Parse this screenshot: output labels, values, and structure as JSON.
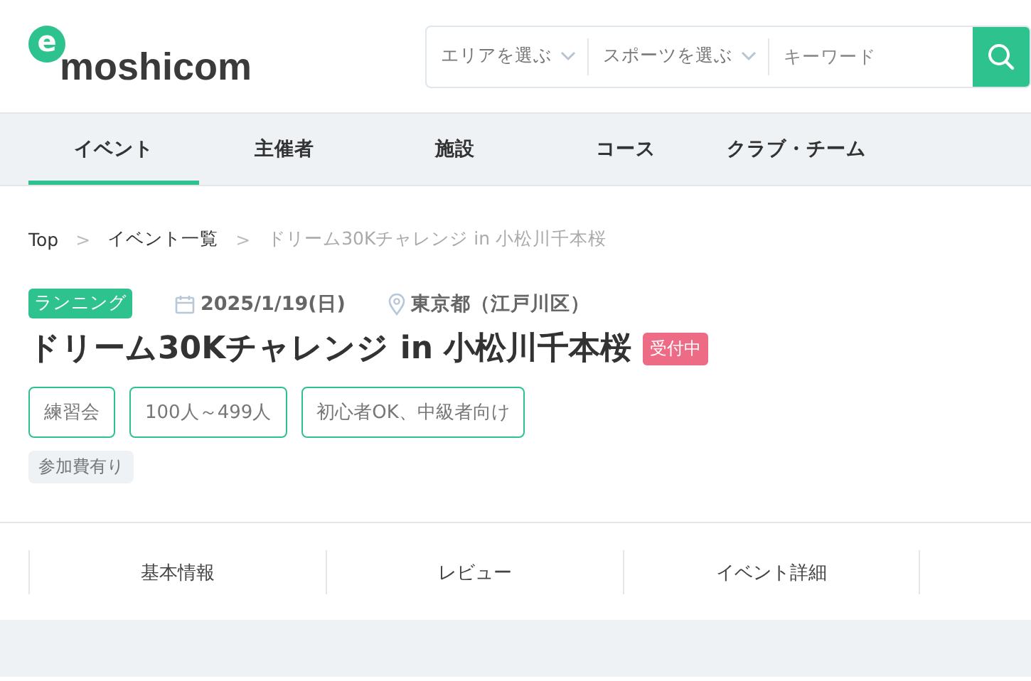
{
  "logo": {
    "mark": "e",
    "wordmark": "moshicom"
  },
  "search": {
    "area": "エリアを選ぶ",
    "sport": "スポーツを選ぶ",
    "placeholder": "キーワード"
  },
  "nav": [
    {
      "label": "イベント",
      "selected": true
    },
    {
      "label": "主催者",
      "selected": false
    },
    {
      "label": "施設",
      "selected": false
    },
    {
      "label": "コース",
      "selected": false
    },
    {
      "label": "クラブ・チーム",
      "selected": false
    }
  ],
  "breadcrumb": [
    {
      "label": "Top",
      "current": false
    },
    {
      "separator": ">",
      "label": "イベント一覧",
      "current": false
    },
    {
      "separator": ">",
      "label": "ドリーム30Kチャレンジ in 小松川千本桜",
      "current": true
    }
  ],
  "event": {
    "category": "ランニング",
    "date": "2025/1/19(日)",
    "location": "東京都（江戸川区）",
    "title": "ドリーム30Kチャレンジ in 小松川千本桜",
    "status": "受付中",
    "tags": [
      "練習会",
      "100人～499人",
      "初心者OK、中級者向け"
    ],
    "fee": "参加費有り"
  },
  "sections": [
    {
      "label": "基本情報"
    },
    {
      "label": "レビュー"
    },
    {
      "label": "イベント詳細"
    }
  ]
}
